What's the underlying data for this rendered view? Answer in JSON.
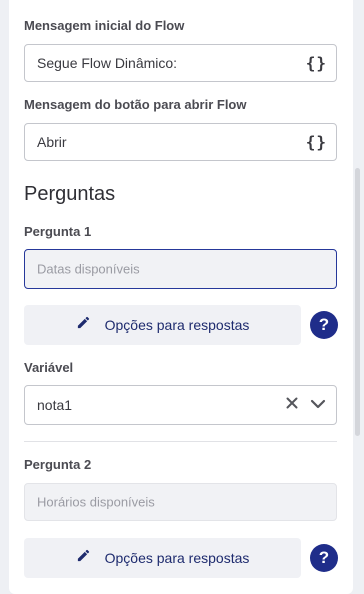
{
  "flow_message": {
    "label": "Mensagem inicial do Flow",
    "value": "Segue Flow Dinâmico:",
    "variable_icon": "curly-braces-icon"
  },
  "button_message": {
    "label": "Mensagem do botão para abrir Flow",
    "value": "Abrir",
    "variable_icon": "curly-braces-icon"
  },
  "questions": {
    "title": "Perguntas",
    "items": [
      {
        "label": "Pergunta 1",
        "placeholder": "Datas disponíveis",
        "options_button": "Opções para respostas",
        "help": "?"
      },
      {
        "label": "Pergunta 2",
        "placeholder": "Horários disponíveis",
        "options_button": "Opções para respostas",
        "help": "?"
      }
    ]
  },
  "variable": {
    "label": "Variável",
    "value": "nota1"
  },
  "colors": {
    "accent": "#1f2d8a",
    "button_bg": "#f0f1f5",
    "field_active_border": "#26389a"
  }
}
